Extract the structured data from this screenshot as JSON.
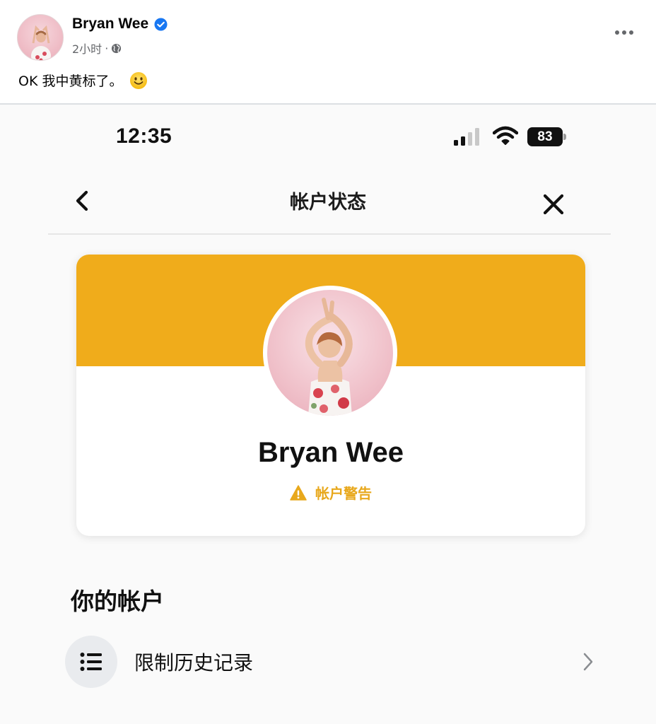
{
  "post": {
    "author_name": "Bryan Wee",
    "time": "2小时",
    "separator": "·",
    "text": "OK 我中黄标了。",
    "emoji": "slightly-smiling-face",
    "colors": {
      "verified": "#1877f2",
      "meta": "#65676b"
    }
  },
  "screenshot": {
    "status_bar": {
      "time": "12:35",
      "battery": "83"
    },
    "nav": {
      "title": "帐户状态",
      "back_icon": "chevron-left-icon",
      "close_icon": "close-icon"
    },
    "card": {
      "name": "Bryan Wee",
      "warning_label": "帐户警告",
      "colors": {
        "banner": "#f0ac1b",
        "warning": "#e8a81c"
      }
    },
    "section_heading": "你的帐户",
    "list": [
      {
        "label": "限制历史记录",
        "icon": "list-icon"
      }
    ]
  }
}
